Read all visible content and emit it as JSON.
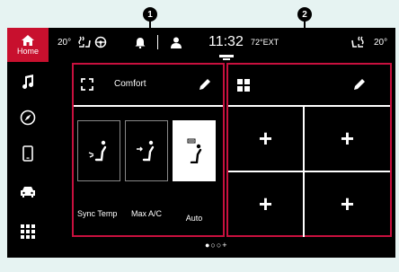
{
  "callouts": [
    "1",
    "2"
  ],
  "sidebar": {
    "home_label": "Home"
  },
  "status": {
    "left_temp": "20°",
    "time": "11:32",
    "ext_temp": "72°EXT",
    "right_temp": "20°"
  },
  "comfort_panel": {
    "title": "Comfort",
    "buttons": [
      {
        "label": "Sync Temp"
      },
      {
        "label": "Max A/C"
      },
      {
        "label": "Auto"
      }
    ]
  },
  "shortcut_panel": {
    "slots": [
      "+",
      "+",
      "+",
      "+"
    ]
  },
  "pager": {
    "text": "●○○+"
  },
  "colors": {
    "accent": "#c8102e",
    "background": "#000000",
    "frame": "#e6f3f2"
  }
}
